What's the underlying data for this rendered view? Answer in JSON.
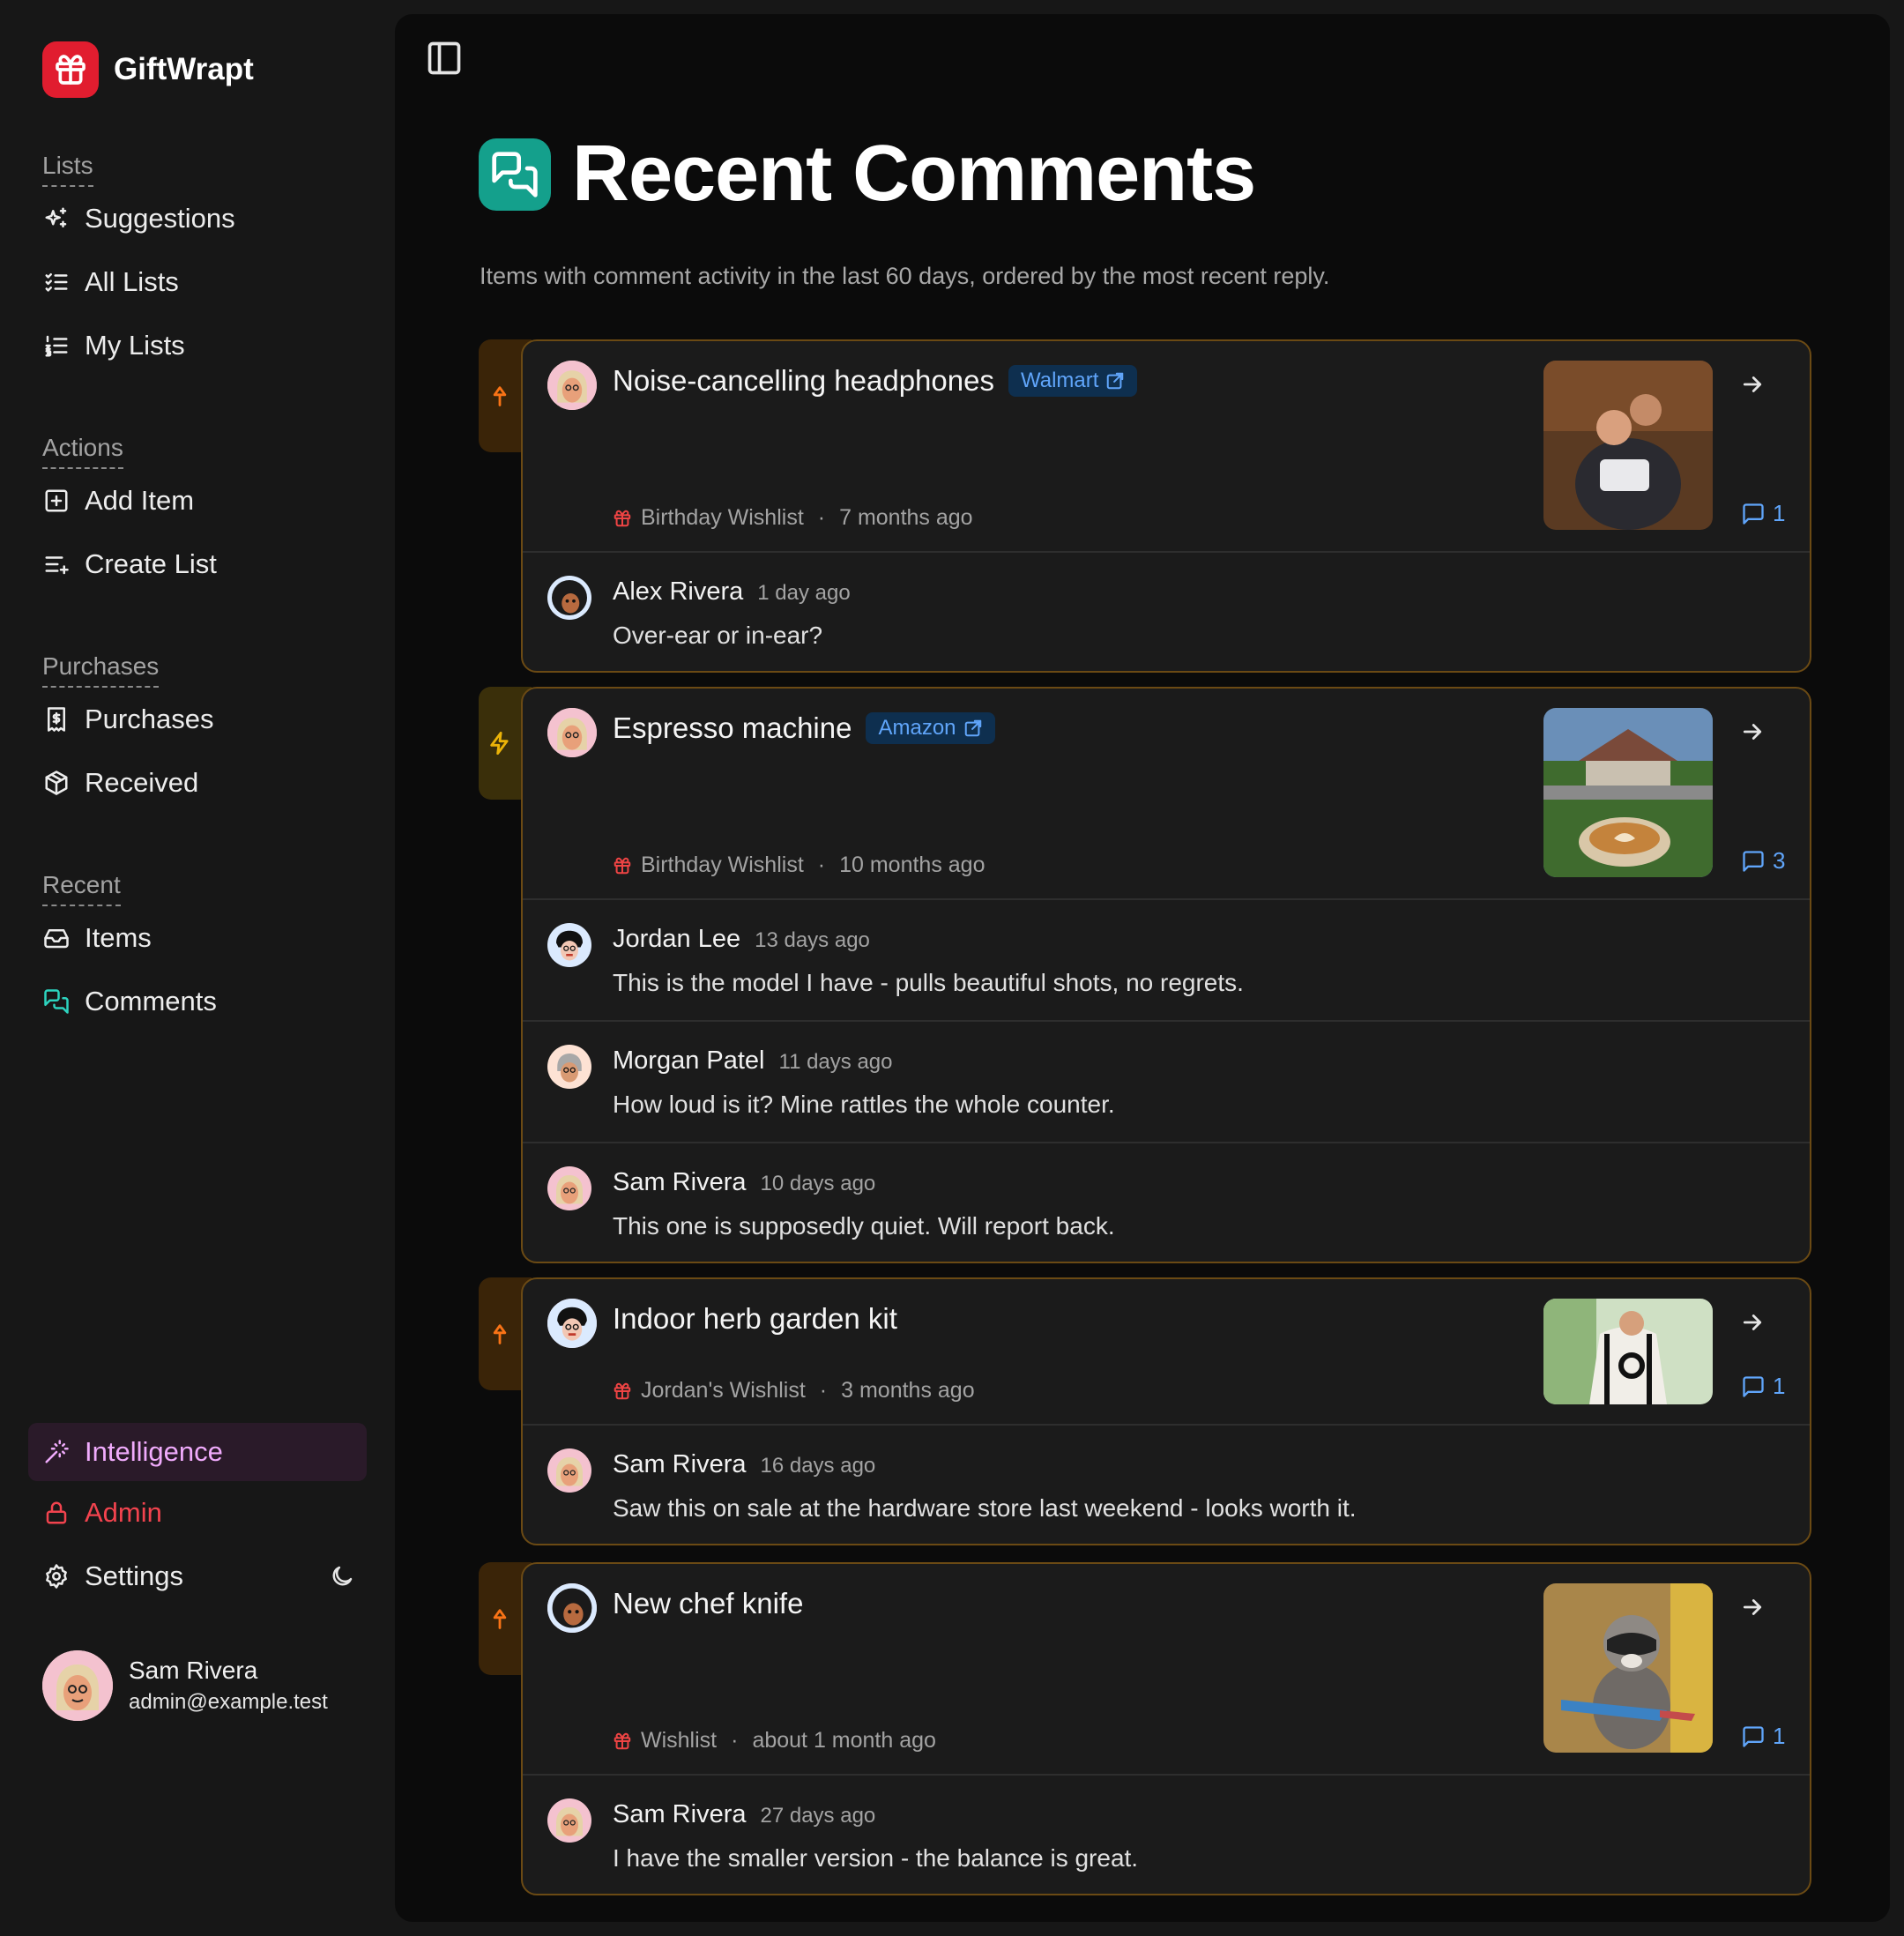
{
  "app": {
    "name": "GiftWrapt"
  },
  "sidebar": {
    "groups": [
      {
        "title": "Lists",
        "items": [
          {
            "label": "Suggestions",
            "icon": "sparkles-icon"
          },
          {
            "label": "All Lists",
            "icon": "list-checks-icon"
          },
          {
            "label": "My Lists",
            "icon": "list-ordered-icon"
          }
        ]
      },
      {
        "title": "Actions",
        "items": [
          {
            "label": "Add Item",
            "icon": "square-plus-icon"
          },
          {
            "label": "Create List",
            "icon": "list-plus-icon"
          }
        ]
      },
      {
        "title": "Purchases",
        "items": [
          {
            "label": "Purchases",
            "icon": "receipt-icon"
          },
          {
            "label": "Received",
            "icon": "package-icon"
          }
        ]
      },
      {
        "title": "Recent",
        "items": [
          {
            "label": "Items",
            "icon": "inbox-icon"
          },
          {
            "label": "Comments",
            "icon": "messages-icon"
          }
        ]
      }
    ],
    "bottom": {
      "intelligence": "Intelligence",
      "admin": "Admin",
      "settings": "Settings"
    },
    "user": {
      "name": "Sam Rivera",
      "email": "admin@example.test"
    }
  },
  "page": {
    "title": "Recent Comments",
    "subtitle": "Items with comment activity in the last 60 days, ordered by the most recent reply."
  },
  "colors": {
    "brand": "#e11d2f",
    "accent_teal": "#14a08c",
    "link_blue": "#60a5fa",
    "card_border": "#6b4a14"
  },
  "items": [
    {
      "name": "Noise-cancelling headphones",
      "store": "Walmart",
      "list": "Birthday Wishlist",
      "age": "7 months ago",
      "comment_count": "1",
      "priority_icon": "arrow-up-icon",
      "comments": [
        {
          "author": "Alex Rivera",
          "time": "1 day ago",
          "text": "Over-ear or in-ear?"
        }
      ]
    },
    {
      "name": "Espresso machine",
      "store": "Amazon",
      "list": "Birthday Wishlist",
      "age": "10 months ago",
      "comment_count": "3",
      "priority_icon": "zap-icon",
      "comments": [
        {
          "author": "Jordan Lee",
          "time": "13 days ago",
          "text": "This is the model I have - pulls beautiful shots, no regrets."
        },
        {
          "author": "Morgan Patel",
          "time": "11 days ago",
          "text": "How loud is it? Mine rattles the whole counter."
        },
        {
          "author": "Sam Rivera",
          "time": "10 days ago",
          "text": "This one is supposedly quiet. Will report back."
        }
      ]
    },
    {
      "name": "Indoor herb garden kit",
      "store": "",
      "list": "Jordan's Wishlist",
      "age": "3 months ago",
      "comment_count": "1",
      "priority_icon": "arrow-up-icon",
      "comments": [
        {
          "author": "Sam Rivera",
          "time": "16 days ago",
          "text": "Saw this on sale at the hardware store last weekend - looks worth it."
        }
      ]
    },
    {
      "name": "New chef knife",
      "store": "",
      "list": "Wishlist",
      "age": "about 1 month ago",
      "comment_count": "1",
      "priority_icon": "arrow-up-icon",
      "comments": [
        {
          "author": "Sam Rivera",
          "time": "27 days ago",
          "text": "I have the smaller version - the balance is great."
        }
      ]
    }
  ]
}
